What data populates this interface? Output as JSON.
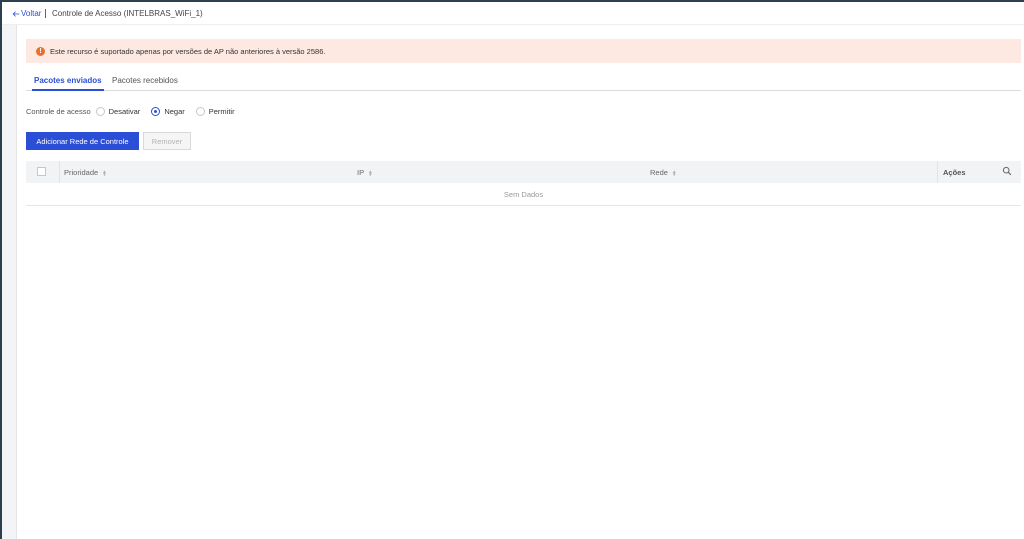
{
  "header": {
    "back_label": "Voltar",
    "title": "Controle de Acesso (INTELBRAS_WiFi_1)"
  },
  "alert": {
    "icon": "exclamation-icon",
    "text": "Este recurso é suportado apenas por versões de AP não anteriores à versão 2586.",
    "color": "#e8712b"
  },
  "tabs": [
    {
      "label": "Pacotes enviados",
      "active": true
    },
    {
      "label": "Pacotes recebidos",
      "active": false
    }
  ],
  "access_control": {
    "label": "Controle de acesso",
    "options": [
      {
        "label": "Desativar",
        "selected": false
      },
      {
        "label": "Negar",
        "selected": true
      },
      {
        "label": "Permitir",
        "selected": false
      }
    ]
  },
  "buttons": {
    "add_label": "Adicionar Rede de Controle",
    "remove_label": "Remover"
  },
  "table": {
    "columns": [
      "Prioridade",
      "IP",
      "Rede",
      "Ações"
    ],
    "empty_text": "Sem Dados"
  },
  "colors": {
    "accent": "#2a4fd6",
    "alert_bg": "#fde9e1",
    "frame": "#2d3e4f"
  }
}
